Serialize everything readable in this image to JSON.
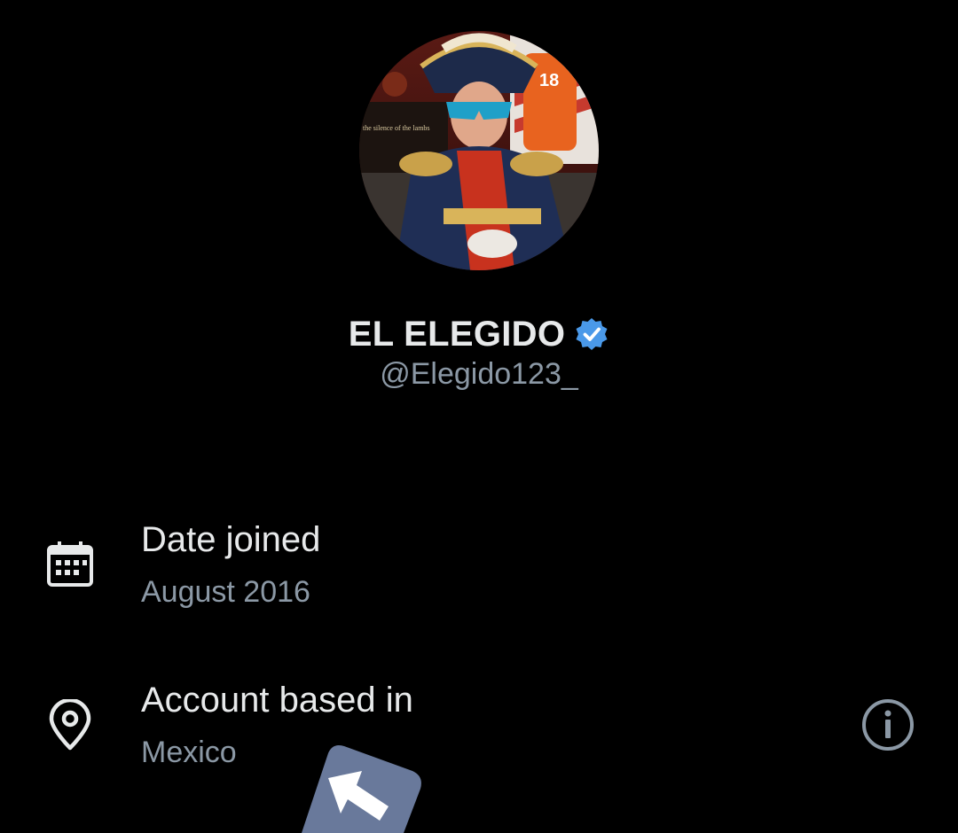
{
  "profile": {
    "avatar_icon": "profile-photo",
    "display_name": "EL ELEGIDO",
    "verified_icon": "verified-badge-icon",
    "verified_color": "#4a99e9",
    "handle": "@Elegido123_"
  },
  "about": {
    "date_joined": {
      "icon": "calendar-icon",
      "title": "Date joined",
      "value": "August 2016"
    },
    "location": {
      "icon": "location-pin-icon",
      "title": "Account based in",
      "value": "Mexico",
      "info_icon": "info-icon"
    }
  },
  "colors": {
    "background": "#000000",
    "primary_text": "#e7e9ea",
    "secondary_text": "#8b98a5"
  }
}
